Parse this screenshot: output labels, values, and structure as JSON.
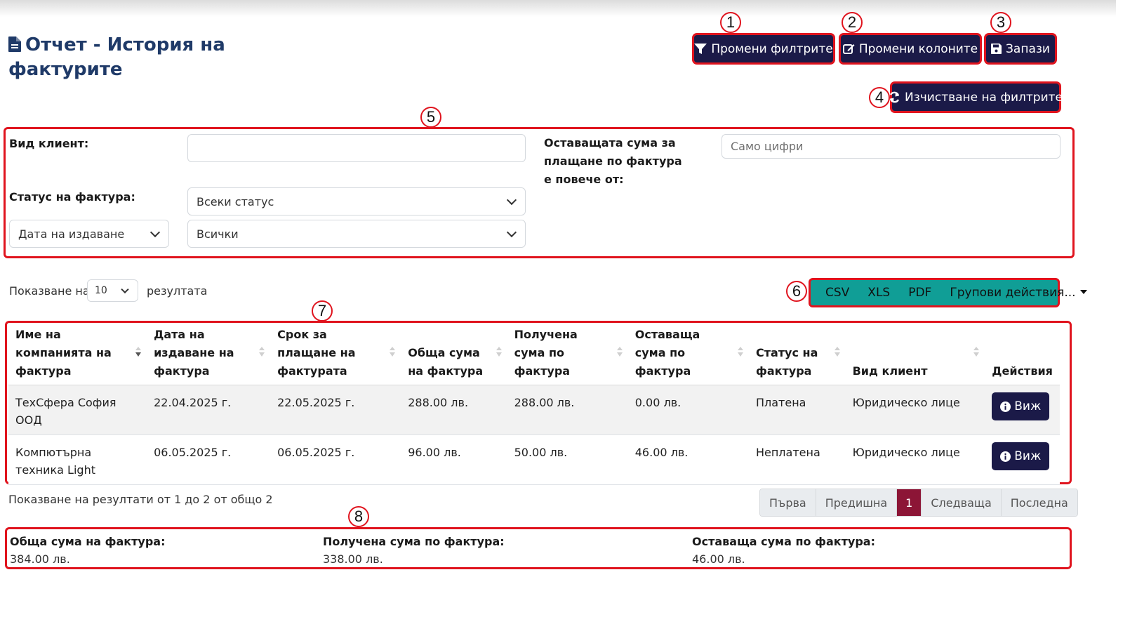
{
  "page": {
    "title": "Отчет - История на фактурите"
  },
  "toolbar": {
    "change_filters": "Промени филтрите",
    "change_columns": "Промени колоните",
    "save": "Запази",
    "clear_filters": "Изчистване на филтрите"
  },
  "markers": [
    "1",
    "2",
    "3",
    "4",
    "5",
    "6",
    "7",
    "8"
  ],
  "filters": {
    "client_type_label": "Вид клиент:",
    "client_type_value": "",
    "status_label": "Статус на фактура:",
    "status_value": "Всеки статус",
    "date_field_value": "Дата на издаване",
    "date_range_value": "Всички",
    "remaining_label": "Оставащата сума за плащане по фактура е повече от:",
    "remaining_placeholder": "Само цифри"
  },
  "list_controls": {
    "show_prefix": "Показване на",
    "page_size": "10",
    "show_suffix": "резултата"
  },
  "export": {
    "csv": "CSV",
    "xls": "XLS",
    "pdf": "PDF",
    "group_actions": "Групови действия..."
  },
  "table": {
    "columns": [
      "Име на компанията на фактура",
      "Дата на издаване на фактура",
      "Срок за плащане на фактурата",
      "Обща сума на фактура",
      "Получена сума по фактура",
      "Оставаща сума по фактура",
      "Статус на фактура",
      "Вид клиент",
      "Действия"
    ],
    "rows": [
      {
        "company": "ТехСфера София ООД",
        "issued": "22.04.2025 г.",
        "due": "22.05.2025 г.",
        "total": "288.00 лв.",
        "received": "288.00 лв.",
        "remaining": "0.00 лв.",
        "status": "Платена",
        "client_type": "Юридическо лице",
        "action": "Виж"
      },
      {
        "company": "Компютърна техника Light",
        "issued": "06.05.2025 г.",
        "due": "06.05.2025 г.",
        "total": "96.00 лв.",
        "received": "50.00 лв.",
        "remaining": "46.00 лв.",
        "status": "Неплатена",
        "client_type": "Юридическо лице",
        "action": "Виж"
      }
    ]
  },
  "results_info": "Показване на резултати от 1 до 2 от общо 2",
  "pagination": {
    "first": "Първа",
    "prev": "Предишна",
    "current": "1",
    "next": "Следваща",
    "last": "Последна"
  },
  "summary": {
    "total_label": "Обща сума на фактура:",
    "total_value": "384.00 лв.",
    "received_label": "Получена сума по фактура:",
    "received_value": "338.00 лв.",
    "remaining_label": "Оставаща сума по фактура:",
    "remaining_value": "46.00 лв."
  },
  "colors": {
    "navy": "#1b1a48",
    "teal": "#109e96",
    "annotation_red": "#e0141e",
    "active_page": "#8c1536",
    "title": "#1f3a68"
  }
}
